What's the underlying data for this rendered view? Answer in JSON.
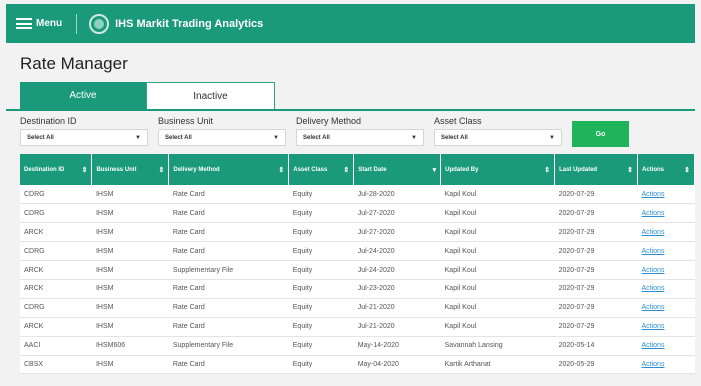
{
  "header": {
    "menu_label": "Menu",
    "app_title": "IHS Markit Trading Analytics"
  },
  "page": {
    "title": "Rate Manager"
  },
  "tabs": [
    {
      "label": "Active",
      "selected": true
    },
    {
      "label": "Inactive",
      "selected": false
    }
  ],
  "filters": [
    {
      "label": "Destination ID",
      "value": "Select All"
    },
    {
      "label": "Business Unit",
      "value": "Select All"
    },
    {
      "label": "Delivery Method",
      "value": "Select All"
    },
    {
      "label": "Asset Class",
      "value": "Select All"
    }
  ],
  "go_label": "Go",
  "table": {
    "columns": [
      "Destination ID",
      "Business Unit",
      "Delivery Method",
      "Asset Class",
      "Start Date",
      "Updated By",
      "Last Updated",
      "Actions"
    ],
    "rows": [
      [
        "CDRG",
        "IHSM",
        "Rate Card",
        "Equity",
        "Jul-28-2020",
        "Kapil Koul",
        "2020-07-29",
        "Actions"
      ],
      [
        "CDRG",
        "IHSM",
        "Rate Card",
        "Equity",
        "Jul-27-2020",
        "Kapil Koul",
        "2020-07-29",
        "Actions"
      ],
      [
        "ARCK",
        "IHSM",
        "Rate Card",
        "Equity",
        "Jul-27-2020",
        "Kapil Koul",
        "2020-07-29",
        "Actions"
      ],
      [
        "CDRG",
        "IHSM",
        "Rate Card",
        "Equity",
        "Jul-24-2020",
        "Kapil Koul",
        "2020-07-29",
        "Actions"
      ],
      [
        "ARCK",
        "IHSM",
        "Supplementary File",
        "Equity",
        "Jul-24-2020",
        "Kapil Koul",
        "2020-07-29",
        "Actions"
      ],
      [
        "ARCK",
        "IHSM",
        "Rate Card",
        "Equity",
        "Jul-23-2020",
        "Kapil Koul",
        "2020-07-29",
        "Actions"
      ],
      [
        "CDRG",
        "IHSM",
        "Rate Card",
        "Equity",
        "Jul-21-2020",
        "Kapil Koul",
        "2020-07-29",
        "Actions"
      ],
      [
        "ARCK",
        "IHSM",
        "Rate Card",
        "Equity",
        "Jul-21-2020",
        "Kapil Koul",
        "2020-07-29",
        "Actions"
      ],
      [
        "AACI",
        "IHSM606",
        "Supplementary File",
        "Equity",
        "May-14-2020",
        "Savannah Lansing",
        "2020-05-14",
        "Actions"
      ],
      [
        "CBSX",
        "IHSM",
        "Rate Card",
        "Equity",
        "May-04-2020",
        "Kartik Arthanat",
        "2020-05-29",
        "Actions"
      ]
    ]
  },
  "colors": {
    "brand": "#1a9a7a",
    "go": "#1fb45a",
    "link": "#2c8fd6"
  }
}
